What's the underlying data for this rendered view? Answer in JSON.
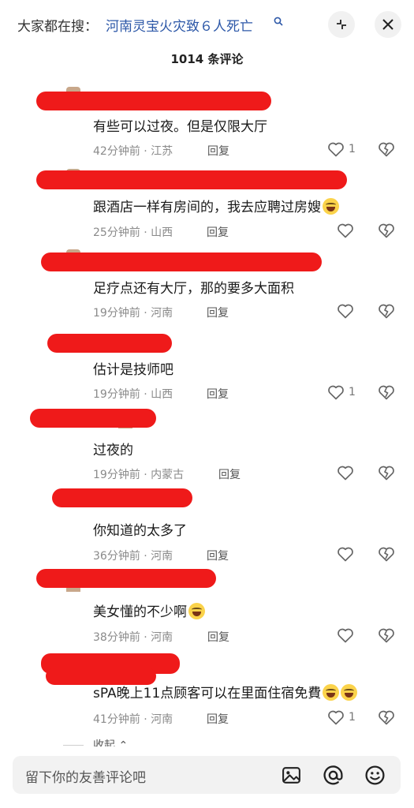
{
  "header": {
    "hot_search_prefix": "大家都在搜：",
    "hot_search_topic": "河南灵宝火灾致６人死亡",
    "comment_count_title": "1014 条评论"
  },
  "icons": {
    "hot_search": "search-icon",
    "collapse": "collapse-arrows-icon",
    "close": "close-icon",
    "like": "heart-icon",
    "dislike": "broken-heart-icon",
    "image": "image-icon",
    "mention": "at-icon",
    "emoji": "smiley-icon",
    "redaction_color": "#ef1a1a"
  },
  "comments": [
    {
      "text": "有些可以过夜。但是仅限大厅",
      "time": "42分钟前 · 江苏",
      "reply": "回复",
      "likes": "1",
      "emoji_count": 0
    },
    {
      "text": "跟酒店一样有房间的，我去应聘过房嫂",
      "time": "25分钟前 · 山西",
      "reply": "回复",
      "likes": "",
      "emoji_count": 1
    },
    {
      "text": "足疗点还有大厅，那的要多大面积",
      "time": "19分钟前 · 河南",
      "reply": "回复",
      "likes": "",
      "emoji_count": 0
    },
    {
      "text": "估计是技师吧",
      "time": "19分钟前 · 山西",
      "reply": "回复",
      "likes": "1",
      "emoji_count": 0
    },
    {
      "text": "过夜的",
      "time": "19分钟前 · 内蒙古",
      "reply": "回复",
      "likes": "",
      "emoji_count": 0
    },
    {
      "text": "你知道的太多了",
      "time": "36分钟前 · 河南",
      "reply": "回复",
      "likes": "",
      "emoji_count": 0
    },
    {
      "text": "美女懂的不少啊",
      "time": "38分钟前 · 河南",
      "reply": "回复",
      "likes": "",
      "emoji_count": 1
    },
    {
      "text": "sPA晚上11点顾客可以在里面住宿免費",
      "time": "41分钟前 · 河南",
      "reply": "回复",
      "likes": "1",
      "emoji_count": 2
    }
  ],
  "collapse_label": "收起",
  "input": {
    "placeholder": "留下你的友善评论吧"
  }
}
